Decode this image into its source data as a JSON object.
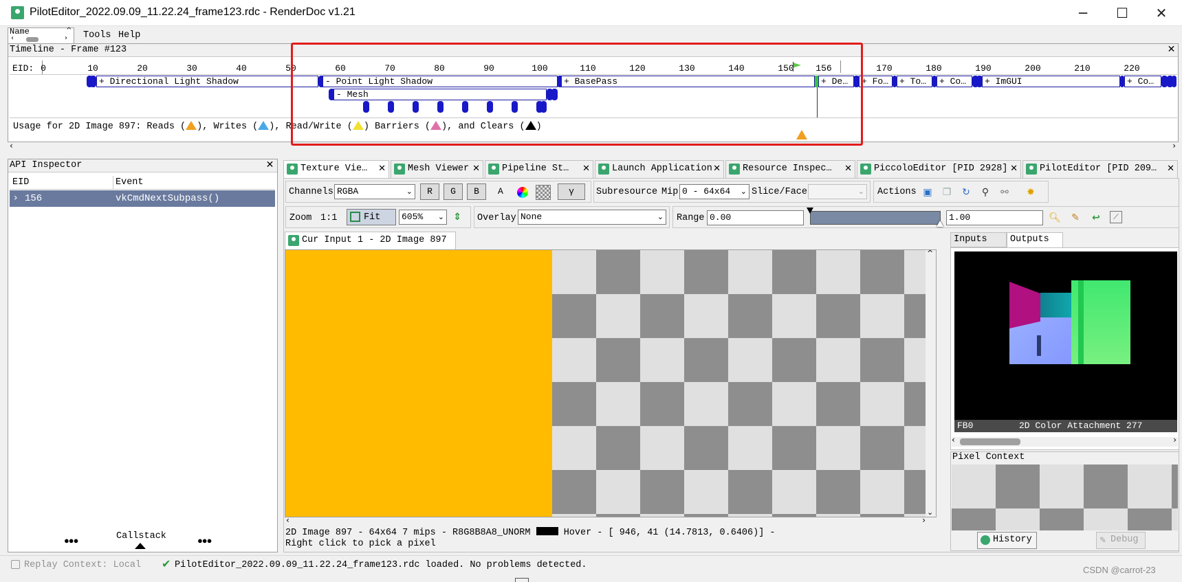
{
  "window": {
    "title": "PilotEditor_2022.09.09_11.22.24_frame123.rdc - RenderDoc v1.21",
    "minimize": "─",
    "maximize": "☐",
    "close": "✕"
  },
  "menu": {
    "name_field": "Name",
    "items": [
      "Tools",
      "Help"
    ]
  },
  "timeline": {
    "title": "Timeline - Frame #123",
    "eid_label": "EID:",
    "ticks": [
      "0",
      "10",
      "20",
      "30",
      "40",
      "50",
      "60",
      "70",
      "80",
      "90",
      "100",
      "110",
      "120",
      "130",
      "140",
      "150",
      "156",
      "170",
      "180",
      "190",
      "200",
      "210",
      "220"
    ],
    "regions": {
      "directional": "+ Directional Light Shadow",
      "point": "- Point Light Shadow",
      "mesh": "- Mesh",
      "basepass": "+ BasePass",
      "de": "+ De…",
      "fo": "+ Fo…",
      "to": "+ To…",
      "co": "+ Co…",
      "imgui": "+ ImGUI",
      "co2": "+ Co…"
    },
    "usage": {
      "prefix": "Usage for 2D Image 897: Reads (",
      "writes": "), Writes (",
      "readwrite": "), Read/Write (",
      "barriers": ") Barriers (",
      "clears": "), and Clears (",
      "suffix": ")"
    }
  },
  "api_inspector": {
    "title": "API Inspector",
    "columns": [
      "EID",
      "Event"
    ],
    "rows": [
      {
        "eid": "156",
        "event": "vkCmdNextSubpass()"
      }
    ],
    "callstack": "Callstack",
    "dots_left": "●●●",
    "dots_right": "●●●"
  },
  "tabs": [
    "Texture Vie…",
    "Mesh Viewer",
    "Pipeline St…",
    "Launch Application",
    "Resource Inspec…",
    "PiccoloEditor [PID 2928]",
    "PilotEditor [PID 209…"
  ],
  "texture_viewer": {
    "channels_label": "Channels",
    "channels_value": "RGBA",
    "channel_buttons": [
      "R",
      "G",
      "B",
      "A"
    ],
    "gamma": "γ",
    "subresource": "Subresource",
    "mip_label": "Mip",
    "mip_value": "0 - 64x64",
    "slice_label": "Slice/Face",
    "actions_label": "Actions",
    "zoom_label": "Zoom",
    "zoom_1to1": "1:1",
    "fit": "Fit",
    "zoom_value": "605%",
    "overlay_label": "Overlay",
    "overlay_value": "None",
    "range_label": "Range",
    "range_min": "0.00",
    "range_max": "1.00",
    "image_tab": "Cur Input 1 - 2D Image 897",
    "status_line1_a": "2D Image 897 - 64x64 7 mips - R8G8B8A8_UNORM",
    "status_line1_b": "Hover - [ 946,   41 (14.7813, 0.6406)] -",
    "status_line2": "Right click to pick a pixel",
    "colors": {
      "orange": "#ffbb00"
    }
  },
  "thumbs": {
    "tabs": [
      "Inputs",
      "Outputs"
    ],
    "thumb_left": "FB0",
    "thumb_right": "2D Color Attachment 277",
    "pixel_context": "Pixel Context",
    "history": "History",
    "debug": "Debug"
  },
  "statusbar": {
    "replay": "Replay Context: Local",
    "message": "PilotEditor_2022.09.09_11.22.24_frame123.rdc loaded.  No problems detected.",
    "watermark": "CSDN @carrot-23"
  },
  "colors": {
    "highlight_red": "#e21b1b",
    "selection": "#6a7a9e",
    "region_border": "#1a1aa0",
    "pill_blue": "#1818c8"
  }
}
